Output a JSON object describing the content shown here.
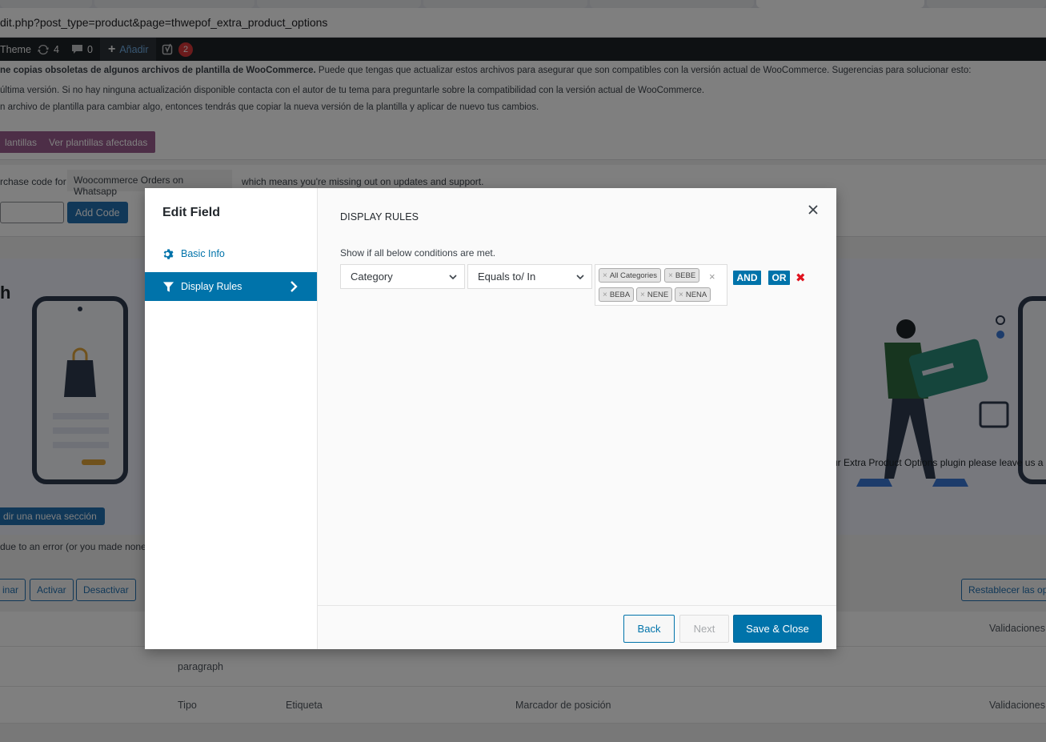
{
  "browser": {
    "url": "dit.php?post_type=product&page=thwepof_extra_product_options"
  },
  "adminbar": {
    "site": "Theme",
    "updates": "4",
    "comments": "0",
    "add_label": "Añadir",
    "seo_badge": "2"
  },
  "notice": {
    "line1_bold": "ne copias obsoletas de algunos archivos de plantilla de WooCommerce.",
    "line1_rest": " Puede que tengas que actualizar estos archivos para asegurar que son compatibles con la versión actual de WooCommerce. Sugerencias para solucionar esto:",
    "line2": "última versión. Si no hay ninguna actualización disponible contacta con el autor de tu tema para preguntarle sobre la compatibilidad con la versión actual de WooCommerce.",
    "line3": "n archivo de plantilla para cambiar algo, entonces tendrás que copiar la nueva versión de la plantilla y aplicar de nuevo tus cambios.",
    "btn1": "lantillas",
    "btn2": "Ver plantillas afectadas"
  },
  "purchase": {
    "prefix": "rchase code for",
    "product": "Woocommerce Orders on Whatsapp",
    "suffix": "which means you're missing out on updates and support.",
    "add_code": "Add Code"
  },
  "banner": {
    "heading": "h",
    "text": "ur Extra Product Options plugin please leave us a",
    "add_section": "dir una nueva sección"
  },
  "page": {
    "error_text": "due to an error (or you made none",
    "btn_delete": "inar",
    "btn_activate": "Activar",
    "btn_deactivate": "Desactivar",
    "btn_reset": "Restablecer las op",
    "col_validations": "Validaciones",
    "row_paragraph": "paragraph",
    "col_type": "Tipo",
    "col_label": "Etiqueta",
    "col_placeholder": "Marcador de posición",
    "col_validations2": "Validaciones"
  },
  "modal": {
    "title": "Edit Field",
    "nav": {
      "basic": "Basic Info",
      "rules": "Display Rules"
    },
    "section_title": "DISPLAY RULES",
    "condition_label": "Show if all below conditions are met.",
    "rule": {
      "operand_type": "Category",
      "operator": "Equals to/ In",
      "values": [
        "All Categories",
        "BEBE",
        "BEBA",
        "NENE",
        "NENA"
      ]
    },
    "and_label": "AND",
    "or_label": "OR",
    "back_label": "Back",
    "next_label": "Next",
    "save_label": "Save & Close"
  }
}
